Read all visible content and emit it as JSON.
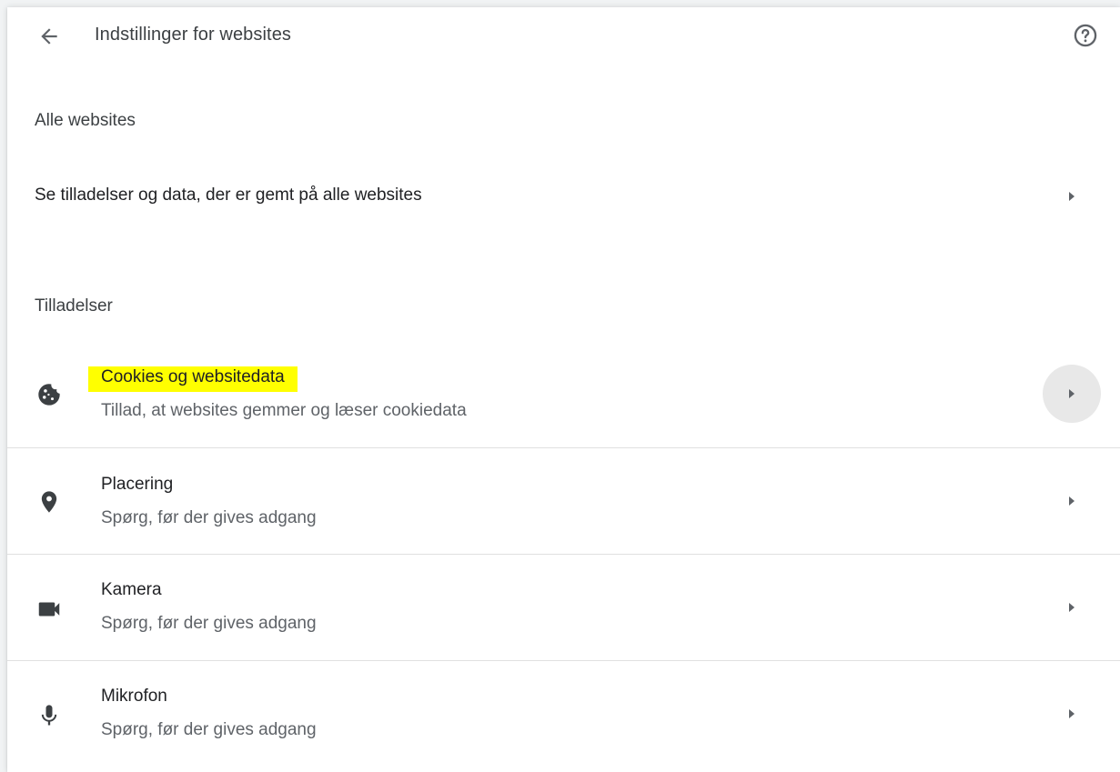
{
  "header": {
    "title": "Indstillinger for websites",
    "back_icon": "arrow-back-icon",
    "help_icon": "help-circle-icon"
  },
  "all_sites": {
    "section_title": "Alle websites",
    "row_label": "Se tilladelser og data, der er gemt på alle websites"
  },
  "permissions": {
    "section_title": "Tilladelser",
    "items": [
      {
        "title": "Cookies og websitedata",
        "subtitle": "Tillad, at websites gemmer og læser cookiedata",
        "icon": "cookie-icon",
        "highlighted": true
      },
      {
        "title": "Placering",
        "subtitle": "Spørg, før der gives adgang",
        "icon": "location-pin-icon"
      },
      {
        "title": "Kamera",
        "subtitle": "Spørg, før der gives adgang",
        "icon": "camera-icon"
      },
      {
        "title": "Mikrofon",
        "subtitle": "Spørg, før der gives adgang",
        "icon": "microphone-icon"
      }
    ]
  },
  "colors": {
    "highlight": "#ffff00",
    "title_text": "#202124",
    "secondary_text": "#5f6368",
    "icon": "#5f6368"
  }
}
